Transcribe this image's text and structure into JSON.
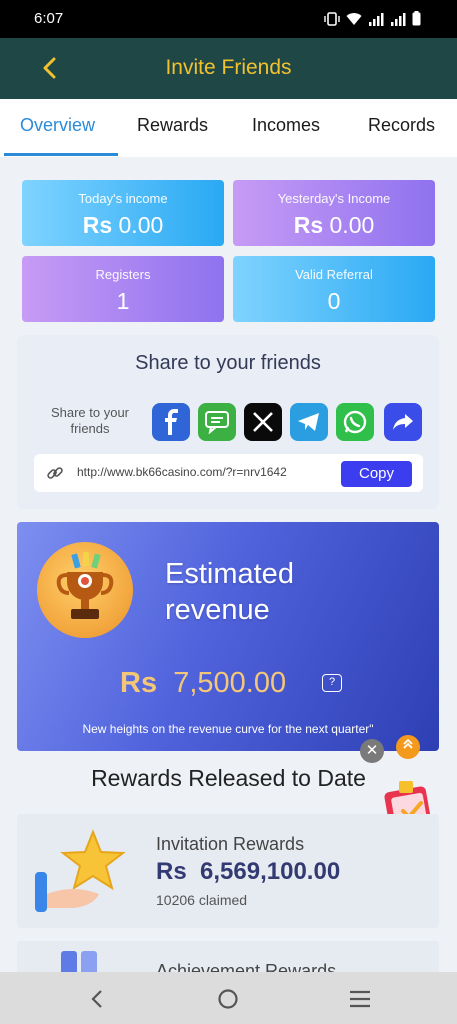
{
  "status_bar": {
    "time": "6:07"
  },
  "header": {
    "title": "Invite Friends"
  },
  "tabs": [
    {
      "label": "Overview",
      "active": true
    },
    {
      "label": "Rewards",
      "active": false
    },
    {
      "label": "Incomes",
      "active": false
    },
    {
      "label": "Records",
      "active": false
    }
  ],
  "stats": [
    {
      "label": "Today's income",
      "currency": "Rs",
      "value": "0.00"
    },
    {
      "label": "Yesterday's Income",
      "currency": "Rs",
      "value": "0.00"
    },
    {
      "label": "Registers",
      "value": "1"
    },
    {
      "label": "Valid Referral",
      "value": "0"
    }
  ],
  "share": {
    "title": "Share to your friends",
    "subtitle": "Share to your friends",
    "link": "http://www.bk66casino.com/?r=nrv1642",
    "copy_label": "Copy",
    "icons": [
      "facebook-icon",
      "message-icon",
      "x-icon",
      "telegram-icon",
      "whatsapp-icon",
      "share-icon"
    ]
  },
  "revenue": {
    "title": "Estimated revenue",
    "currency": "Rs",
    "amount": "7,500.00",
    "help": "?",
    "note": "New heights on the revenue curve for the next quarter\""
  },
  "rewards_section": {
    "title": "Rewards Released to Date",
    "items": [
      {
        "label": "Invitation Rewards",
        "currency": "Rs",
        "amount": "6,569,100.00",
        "claimed": "10206 claimed"
      },
      {
        "label": "Achievement Rewards"
      }
    ]
  },
  "colors": {
    "header_bg": "#1e4746",
    "header_title": "#f2c12e",
    "tab_active": "#2c8bd9",
    "copy_button": "#3d3df0",
    "revenue_amount": "#f4c778"
  }
}
